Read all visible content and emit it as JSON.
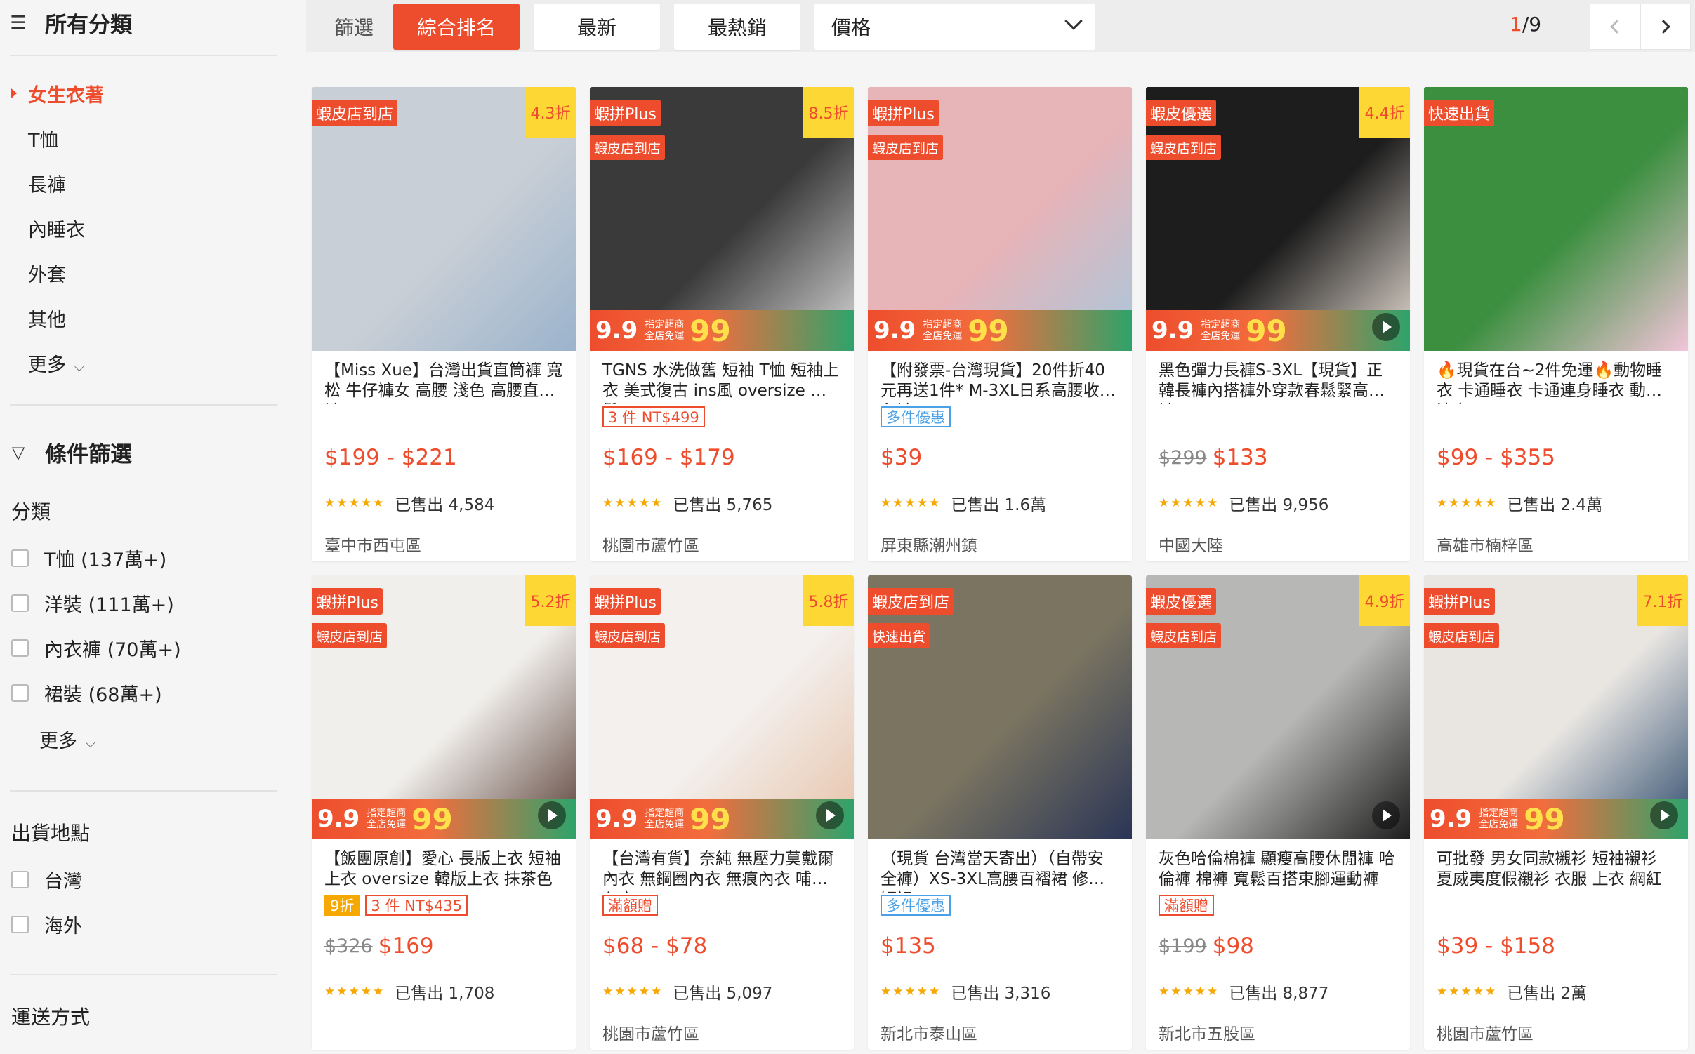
{
  "sidebar": {
    "all_categories_label": "所有分類",
    "categories": [
      {
        "label": "女生衣著",
        "active": true
      },
      {
        "label": "T恤"
      },
      {
        "label": "長褲"
      },
      {
        "label": "內睡衣"
      },
      {
        "label": "外套"
      },
      {
        "label": "其他"
      }
    ],
    "more_label": "更多",
    "filter_label": "條件篩選",
    "classification_label": "分類",
    "classification_options": [
      "T恤 (137萬+)",
      "洋裝 (111萬+)",
      "內衣褲 (70萬+)",
      "裙裝 (68萬+)"
    ],
    "classification_more": "更多",
    "shipping_location_label": "出貨地點",
    "shipping_options": [
      "台灣",
      "海外"
    ],
    "shipping_method_label": "運送方式"
  },
  "sortbar": {
    "label": "篩選",
    "buttons": [
      "綜合排名",
      "最新",
      "最熱銷"
    ],
    "price_label": "價格",
    "page_current": "1",
    "page_total": "/9"
  },
  "products": [
    {
      "title": "【Miss Xue】台灣出貨直筒褲 寬松 牛仔褲女 高腰 淺色 高腰直筒褲",
      "badge1": "蝦皮店到店",
      "badge2": "",
      "discount": "4.3折",
      "strip": false,
      "tags": [],
      "orig_price": "",
      "price": "$199 - $221",
      "sold": "已售出 4,584",
      "location": "臺中市西屯區",
      "play": false,
      "img_color": "#c9cfd6",
      "img_color2": "#9bb3cc"
    },
    {
      "title": "TGNS 水洗做舊 短袖 T恤 短袖上衣 美式復古 ins風 oversize 寬鬆",
      "badge1": "蝦拼Plus",
      "badge2": "蝦皮店到店",
      "discount": "8.5折",
      "strip": true,
      "tags": [
        {
          "text": "3 件 NT$499",
          "style": "red"
        }
      ],
      "orig_price": "",
      "price": "$169 - $179",
      "sold": "已售出 5,765",
      "location": "桃園市蘆竹區",
      "play": false,
      "img_color": "#3a3a3a",
      "img_color2": "#d8d8d8"
    },
    {
      "title": "【附發票-台灣現貨】20件折40元再送1件* M-3XL日系高腰收腹內褲",
      "badge1": "蝦拼Plus",
      "badge2": "蝦皮店到店",
      "discount": "",
      "strip": true,
      "tags": [
        {
          "text": "多件優惠",
          "style": "blue"
        }
      ],
      "orig_price": "",
      "price": "$39",
      "sold": "已售出 1.6萬",
      "location": "屏東縣潮州鎮",
      "play": false,
      "img_color": "#e7b4b8",
      "img_color2": "#a9c7dc"
    },
    {
      "title": "黑色彈力長褲S-3XL【現貨】正韓長褲內搭褲外穿款春鬆緊高腰褲",
      "badge1": "蝦皮優選",
      "badge2": "蝦皮店到店",
      "discount": "4.4折",
      "strip": true,
      "tags": [],
      "orig_price": "$299",
      "price": "$133",
      "sold": "已售出 9,956",
      "location": "中國大陸",
      "play": true,
      "img_color": "#1d1d1d",
      "img_color2": "#e9dfd5"
    },
    {
      "title": "🔥現貨在台~2件免運🔥動物睡衣 卡通睡衣 卡通連身睡衣 動物連身",
      "badge1": "快速出貨",
      "badge2": "",
      "discount": "",
      "strip": false,
      "tags": [],
      "orig_price": "",
      "price": "$99 - $355",
      "sold": "已售出 2.4萬",
      "location": "高雄市楠梓區",
      "play": false,
      "img_color": "#3b8f3f",
      "img_color2": "#f2c5d9"
    },
    {
      "title": "【飯團原創】愛心 長版上衣 短袖上衣 oversize 韓版上衣 抹茶色",
      "badge1": "蝦拼Plus",
      "badge2": "蝦皮店到店",
      "discount": "5.2折",
      "strip": true,
      "tags": [
        {
          "text": "9折",
          "style": "gold"
        },
        {
          "text": "3 件 NT$435",
          "style": "red"
        }
      ],
      "orig_price": "$326",
      "price": "$169",
      "sold": "已售出 1,708",
      "location": "",
      "play": true,
      "img_color": "#f1efec",
      "img_color2": "#5a4037"
    },
    {
      "title": "【台灣有貨】奈純 無壓力莫戴爾內衣 無鋼圈內衣 無痕內衣 哺乳內衣",
      "badge1": "蝦拼Plus",
      "badge2": "蝦皮店到店",
      "discount": "5.8折",
      "strip": true,
      "tags": [
        {
          "text": "滿額贈",
          "style": "red"
        }
      ],
      "orig_price": "",
      "price": "$68 - $78",
      "sold": "已售出 5,097",
      "location": "桃園市蘆竹區",
      "play": true,
      "img_color": "#f3f0ee",
      "img_color2": "#e7c2a8"
    },
    {
      "title": "（現貨 台灣當天寄出）（自帶安全褲）XS-3XL高腰百褶裙 修身短裙",
      "badge1": "蝦皮店到店",
      "badge2": "快速出貨",
      "discount": "",
      "strip": false,
      "tags": [
        {
          "text": "多件優惠",
          "style": "blue"
        }
      ],
      "orig_price": "",
      "price": "$135",
      "sold": "已售出 3,316",
      "location": "新北市泰山區",
      "play": false,
      "img_color": "#7a7460",
      "img_color2": "#2a3556"
    },
    {
      "title": "灰色哈倫棉褲 顯瘦高腰休閒褲 哈倫褲 棉褲 寬鬆百搭束腳運動褲",
      "badge1": "蝦皮優選",
      "badge2": "蝦皮店到店",
      "discount": "4.9折",
      "strip": false,
      "tags": [
        {
          "text": "滿額贈",
          "style": "red"
        }
      ],
      "orig_price": "$199",
      "price": "$98",
      "sold": "已售出 8,877",
      "location": "新北市五股區",
      "play": true,
      "img_color": "#b7b7b5",
      "img_color2": "#1e1e1e"
    },
    {
      "title": "可批發 男女同款襯衫 短袖襯衫 夏威夷度假襯衫 衣服 上衣 網紅",
      "badge1": "蝦拼Plus",
      "badge2": "蝦皮店到店",
      "discount": "7.1折",
      "strip": true,
      "tags": [],
      "orig_price": "",
      "price": "$39 - $158",
      "sold": "已售出 2萬",
      "location": "桃園市蘆竹區",
      "play": true,
      "img_color": "#e9e6e2",
      "img_color2": "#2f4c6e"
    }
  ],
  "strip_text": {
    "n99": "9.9",
    "mid_line1": "指定超商",
    "mid_line2": "全店免運",
    "big99": "99"
  },
  "colors": {
    "accent": "#ee4d2d",
    "stars": "#f6a700"
  }
}
